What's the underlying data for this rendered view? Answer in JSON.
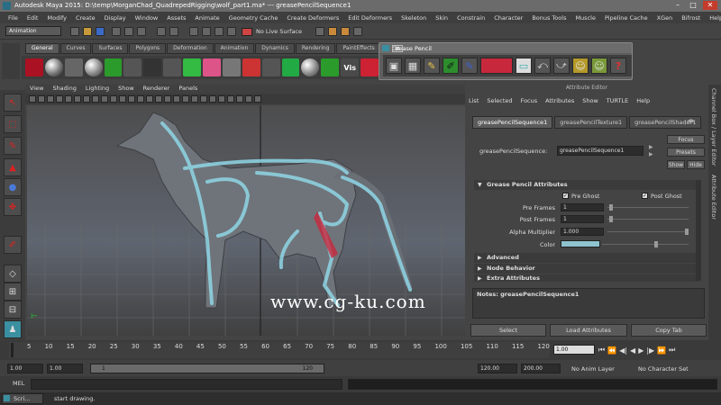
{
  "titlebar": {
    "title": "Autodesk Maya 2015: D:\\temp\\MorganChad_QuadrepedRigging\\wolf_part1.ma*   ---   greasePencilSequence1",
    "min": "–",
    "max": "□",
    "close": "✕"
  },
  "menubar": [
    "File",
    "Edit",
    "Modify",
    "Create",
    "Display",
    "Window",
    "Assets",
    "Animate",
    "Geometry Cache",
    "Create Deformers",
    "Edit Deformers",
    "Skeleton",
    "Skin",
    "Constrain",
    "Character",
    "Bonus Tools",
    "Muscle",
    "Pipeline Cache",
    "XGen",
    "Bifrost",
    "Help"
  ],
  "statusline": {
    "mode": "Animation",
    "live_surface": "No Live Surface"
  },
  "shelf_tabs": [
    "General",
    "Curves",
    "Surfaces",
    "Polygons",
    "Deformation",
    "Animation",
    "Dynamics",
    "Rendering",
    "PaintEffects"
  ],
  "shelf_vis_label": "Vis",
  "grease_pencil": {
    "title": "Grease Pencil",
    "color": "#c8283c"
  },
  "viewport_menu": [
    "View",
    "Shading",
    "Lighting",
    "Show",
    "Renderer",
    "Panels"
  ],
  "watermark": "www.cg-ku.com",
  "attribute_editor": {
    "caption": "Attribute Editor",
    "menu": [
      "List",
      "Selected",
      "Focus",
      "Attributes",
      "Show",
      "TURTLE",
      "Help"
    ],
    "tabs": [
      "greasePencilSequence1",
      "greasePencilTexture1",
      "greasePencilShader1"
    ],
    "node_label": "greasePencilSequence:",
    "node_value": "greasePencilSequence1",
    "focus": "Focus",
    "presets": "Presets",
    "show": "Show",
    "hide": "Hide",
    "section_main": "Grease Pencil Attributes",
    "pre_ghost": "Pre Ghost",
    "post_ghost": "Post Ghost",
    "pre_frames_label": "Pre Frames",
    "pre_frames": "1",
    "post_frames_label": "Post Frames",
    "post_frames": "1",
    "alpha_label": "Alpha Multiplier",
    "alpha": "1.000",
    "color_label": "Color",
    "color_swatch": "#8fc3cf",
    "sections": [
      "Advanced",
      "Node Behavior",
      "Extra Attributes"
    ],
    "notes": "Notes:  greasePencilSequence1",
    "buttons": [
      "Select",
      "Load Attributes",
      "Copy Tab"
    ]
  },
  "side_tabs": [
    "Channel Box / Layer Editor",
    "Attribute Editor"
  ],
  "timeline": {
    "ticks": [
      "5",
      "10",
      "15",
      "20",
      "25",
      "30",
      "35",
      "40",
      "45",
      "50",
      "55",
      "60",
      "65",
      "70",
      "75",
      "80",
      "85",
      "90",
      "95",
      "100",
      "105",
      "110",
      "115",
      "120"
    ],
    "current": "1.00"
  },
  "range": {
    "start": "1.00",
    "start2": "1.00",
    "slider_start": "1",
    "slider_end": "120",
    "end": "120.00",
    "end2": "200.00",
    "anim_layer": "No Anim Layer",
    "character": "No Character Set"
  },
  "cmdline": {
    "label": "MEL"
  },
  "taskbar": {
    "item": "Scri...",
    "message": "start drawing."
  }
}
